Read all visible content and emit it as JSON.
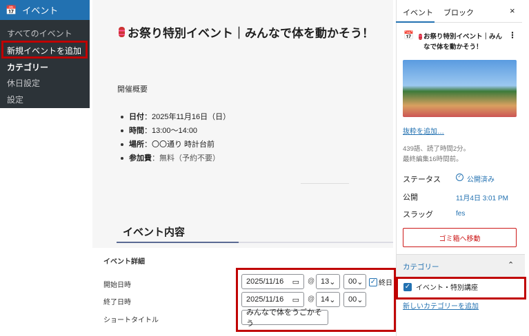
{
  "admin_menu": {
    "header": "イベント",
    "items": [
      "すべてのイベント",
      "新規イベントを追加",
      "カテゴリー",
      "休日設定",
      "設定"
    ]
  },
  "editor": {
    "title": "お祭り特別イベント｜みんなで体を動かそう！",
    "overview": "開催概要",
    "list": [
      {
        "k": "日付",
        "v": "：2025年11月16日（日）"
      },
      {
        "k": "時間",
        "v": "：13:00〜14:00"
      },
      {
        "k": "場所",
        "v": "：〇〇通り 時計台前"
      },
      {
        "k": "参加費",
        "v": "：無料（予約不要）"
      }
    ],
    "section_heading": "イベント内容"
  },
  "metabox": {
    "title": "イベント詳細",
    "start_label": "開始日時",
    "end_label": "終了日時",
    "short_label": "ショートタイトル",
    "start_date": "2025/11/16",
    "start_hour": "13",
    "start_min": "00",
    "allday_label": "終日",
    "allday_checked": true,
    "end_date": "2025/11/16",
    "end_hour": "14",
    "end_min": "00",
    "at": "@",
    "short_title": "みんなで体をうごかそう"
  },
  "sidebar": {
    "tabs": [
      "イベント",
      "ブロック"
    ],
    "close": "×",
    "post_title": "お祭り特別イベント｜みんなで体を動かそう！",
    "excerpt_link": "抜粋を追加…",
    "stats1": "439語、読了時間2分。",
    "stats2": "最終編集16時間前。",
    "status_label": "ステータス",
    "status_value": "公開済み",
    "publish_label": "公開",
    "publish_value": "11月4日 3:01 PM",
    "slug_label": "スラッグ",
    "slug_value": "fes",
    "trash_button": "ゴミ箱へ移動",
    "category_heading": "カテゴリー",
    "category_item": "イベント・特別講座",
    "category_checked": true,
    "add_category": "新しいカテゴリーを追加"
  },
  "colors": {
    "accent": "#2271b1",
    "highlight": "#c00000",
    "danger": "#cc1818"
  }
}
